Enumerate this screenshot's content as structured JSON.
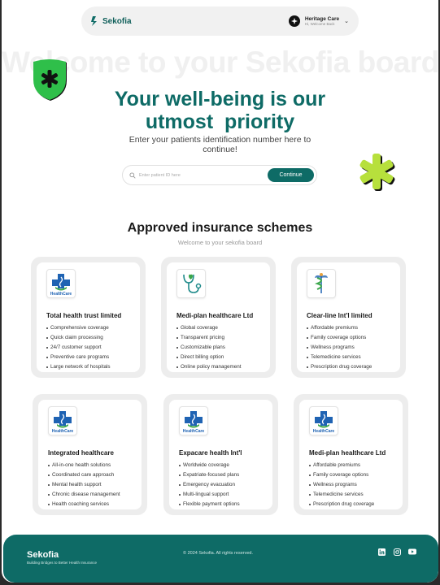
{
  "navbar": {
    "brand": "Sekofia",
    "user_name": "Heritage Care",
    "user_subtitle": "Hi, Welcome Back"
  },
  "hero": {
    "background_text": "Welcome to your Sekofia board",
    "title_line1": "Your well-being is our",
    "title_line2": "utmost  priority",
    "subtitle": "Enter your patients identification number here to continue!",
    "search_placeholder": "Enter patient ID here",
    "continue_label": "Continue"
  },
  "schemes": {
    "title": "Approved insurance schemes",
    "subtitle": "Welcome to your sekofia board",
    "cards": [
      {
        "name": "Total health trust limited",
        "logo": "healthcare-cross-logo",
        "features": [
          "Comprehensive coverage",
          "Quick claim processing",
          "24/7 customer support",
          "Preventive care programs",
          "Large network of hospitals"
        ]
      },
      {
        "name": "Medi-plan healthcare Ltd",
        "logo": "stethoscope-heart-logo",
        "features": [
          "Global coverage",
          "Transparent pricing",
          "Customizable plans",
          "Direct billing option",
          "Online policy management"
        ]
      },
      {
        "name": "Clear-line Int'l limited",
        "logo": "caduceus-logo",
        "features": [
          "Affordable premiums",
          "Family coverage options",
          "Wellness programs",
          "Telemedicine services",
          "Prescription drug coverage"
        ]
      },
      {
        "name": "Integrated healthcare",
        "logo": "healthcare-cross-logo",
        "features": [
          "All-in-one health solutions",
          "Coordinated care approach",
          "Mental health support",
          "Chronic disease management",
          "Health coaching services"
        ]
      },
      {
        "name": "Expacare health Int'l",
        "logo": "healthcare-cross-logo",
        "features": [
          "Worldwide coverage",
          "Expatriate-focused plans",
          "Emergency evacuation",
          "Multi-lingual support",
          "Flexible payment options"
        ]
      },
      {
        "name": "Medi-plan healthcare Ltd",
        "logo": "healthcare-cross-logo",
        "features": [
          "Affordable premiums",
          "Family coverage options",
          "Wellness programs",
          "Telemedicine services",
          "Prescription drug coverage"
        ]
      }
    ],
    "logo_caption": "HealthCare"
  },
  "footer": {
    "brand": "Sekofia",
    "tagline": "Building Bridges to Better Health Insurance",
    "copyright": "© 2024 Sekofia. All rights reserved.",
    "socials": [
      "linkedin-icon",
      "instagram-icon",
      "youtube-icon"
    ]
  },
  "colors": {
    "brand_teal": "#0e6b66",
    "accent_green": "#b7e03c",
    "shield_green": "#2fbf4a"
  }
}
